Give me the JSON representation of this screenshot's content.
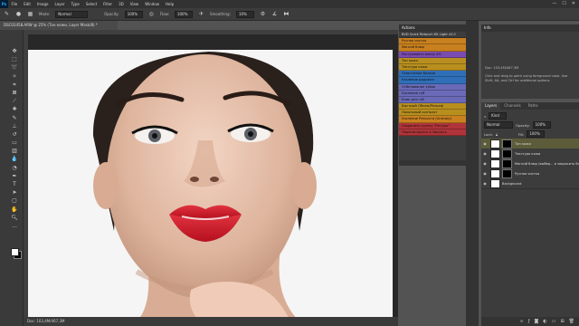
{
  "app": {
    "logo": "Ps"
  },
  "menu": [
    "File",
    "Edit",
    "Image",
    "Layer",
    "Type",
    "Select",
    "Filter",
    "3D",
    "View",
    "Window",
    "Help"
  ],
  "window_controls": [
    "—",
    "☐",
    "✕"
  ],
  "options_bar": {
    "mode_label": "Mode:",
    "mode_value": "Normal",
    "opacity_label": "Opacity:",
    "opacity_value": "100%",
    "flow_label": "Flow:",
    "flow_value": "100%",
    "smoothing_label": "Smoothing:",
    "smoothing_value": "10%"
  },
  "doc_tab": "DSC02458.ARW @ 25% (Тон кожи, Layer Mask/8) *",
  "status_bar": "Doc: 103,4M/467,3M",
  "actions": {
    "title": "Actions",
    "items": [
      {
        "label": "BVD Quick Retouch Kit Light v2.0",
        "color": "#3c3c3c",
        "plain": true
      },
      {
        "label": "Ручная чистка",
        "color": "#c9801e"
      },
      {
        "label": "Мягкий блюр",
        "color": "#c9801e"
      },
      {
        "label": "Растушевать маску 4%",
        "color": "#7a4bb0"
      },
      {
        "label": "Тон кожи",
        "color": "#b88f1f"
      },
      {
        "label": "Текстура кожи",
        "color": "#b88f1f"
      },
      {
        "label": "Осветление белков",
        "color": "#2f6fb8"
      },
      {
        "label": "Усиление радужки",
        "color": "#2f6fb8"
      },
      {
        "label": "Отбеливание зубов",
        "color": "#6a6ab8"
      },
      {
        "label": "Усиление губ",
        "color": "#6a6ab8"
      },
      {
        "label": "Блик для губ",
        "color": "#6a6ab8"
      },
      {
        "label": "Быстрый Объем/Рельеф",
        "color": "#b88f1f"
      },
      {
        "label": "Локальный контраст",
        "color": "#b88f1f"
      },
      {
        "label": "Усиление Резкости (Unsharp)",
        "color": "#c9801e"
      },
      {
        "label": "Сохранить группу \"Ретушь\"",
        "color": "#b0343a"
      },
      {
        "label": "Перенастроить и Закрыть",
        "color": "#b0343a"
      }
    ]
  },
  "info": {
    "title": "Info",
    "doc": "Doc: 103,4M/467,3M",
    "hint": "Click and drag to paint using foreground color. Use Shift, Alt, and Ctrl for additional options."
  },
  "layers": {
    "tabs": [
      "Layers",
      "Channels",
      "Paths"
    ],
    "kind_label": "Kind",
    "blend_mode": "Normal",
    "opacity_label": "Opacity:",
    "opacity_value": "100%",
    "lock_label": "Lock:",
    "fill_label": "Fill:",
    "fill_value": "100%",
    "rows": [
      {
        "name": "Тон кожи",
        "selected": true
      },
      {
        "name": "Текстура кожи",
        "selected": false
      },
      {
        "name": "Мягкий блюр (выбер... в закрасить блюр)",
        "selected": false
      },
      {
        "name": "Ручная чистка",
        "selected": false
      },
      {
        "name": "Background",
        "selected": false
      }
    ]
  },
  "colors": {
    "accent": "#31a8ff",
    "photo_bg": "#f4f4f4",
    "lips": "#d0182a"
  }
}
